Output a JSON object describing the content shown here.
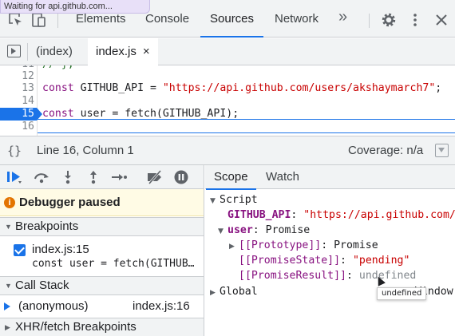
{
  "status_text": "Waiting for api.github.com...",
  "main_tabs": [
    "Elements",
    "Console",
    "Sources",
    "Network"
  ],
  "active_main_tab": "Sources",
  "more_tabs_glyph": "»",
  "file_tabs": {
    "index": "(index)",
    "active": "index.js",
    "close": "×"
  },
  "code": {
    "lines": [
      {
        "num": "11",
        "text": "// };"
      },
      {
        "num": "12",
        "text": ""
      },
      {
        "num": "13",
        "keyword": "const",
        "name": " GITHUB_API = ",
        "string": "\"https://api.github.com/users/akshaymarch7\"",
        "tail": ";"
      },
      {
        "num": "14",
        "text": ""
      },
      {
        "num": "15",
        "keyword": "const",
        "name": " user = fetch(GITHUB_API);",
        "breakpoint": true
      },
      {
        "num": "16",
        "text": ""
      }
    ]
  },
  "statusbar": {
    "braces": "{}",
    "position": "Line 16, Column 1",
    "coverage": "Coverage: n/a"
  },
  "debugger": {
    "paused": "Debugger paused",
    "breakpoints_label": "Breakpoints",
    "breakpoint_file": "index.js:15",
    "breakpoint_code": "const user = fetch(GITHUB…",
    "call_stack_label": "Call Stack",
    "frame_name": "(anonymous)",
    "frame_location": "index.js:16",
    "xhr_label": "XHR/fetch Breakpoints"
  },
  "scope": {
    "tabs": [
      "Scope",
      "Watch"
    ],
    "script_label": "Script",
    "github_api_key": "GITHUB_API",
    "github_api_val": "\"https://api.github.com/u",
    "user_key": "user",
    "user_val": "Promise",
    "proto_key": "[[Prototype]]",
    "proto_val": "Promise",
    "state_key": "[[PromiseState]]",
    "state_val": "\"pending\"",
    "result_key": "[[PromiseResult]]",
    "result_val": "undefined",
    "global_label": "Global",
    "global_val": "Window",
    "tooltip": "undefined"
  },
  "colors": {
    "accent": "#1a73e8",
    "keyword": "#881280",
    "string": "#c80000",
    "paused_bg": "#fffbe5"
  }
}
